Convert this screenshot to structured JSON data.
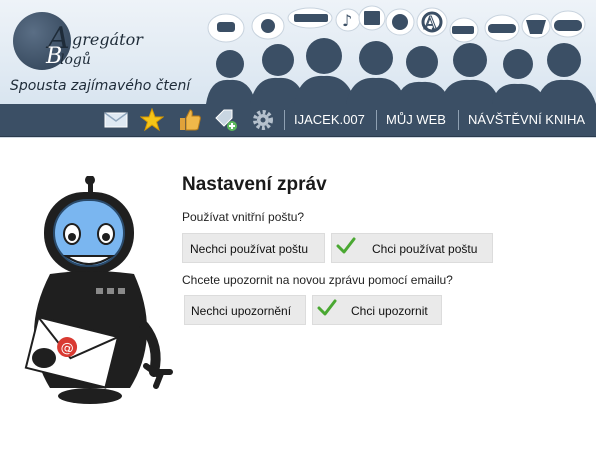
{
  "logo": {
    "line1": "gregátor",
    "line2": "logů",
    "tagline": "Spousta zajímavého čtení"
  },
  "nav": {
    "icons": [
      "mail-icon",
      "star-icon",
      "thumbs-up-icon",
      "tag-add-icon",
      "gear-icon"
    ],
    "links": [
      "IJACEK.007",
      "MŮJ WEB",
      "NÁVŠTĚVNÍ KNIHA"
    ]
  },
  "page": {
    "title": "Nastavení zpráv",
    "q1": "Používat vnitřní poštu?",
    "q1_no": "Nechci používat poštu",
    "q1_yes": "Chci používat poštu",
    "q2": "Chcete upozornit na novou zprávu pomocí emailu?",
    "q2_no": "Nechci upozornění",
    "q2_yes": "Chci upozornit"
  },
  "colors": {
    "navbar": "#3b4f65",
    "check": "#4aa832",
    "button": "#eaeaea",
    "robot_face": "#7ab6f0"
  }
}
